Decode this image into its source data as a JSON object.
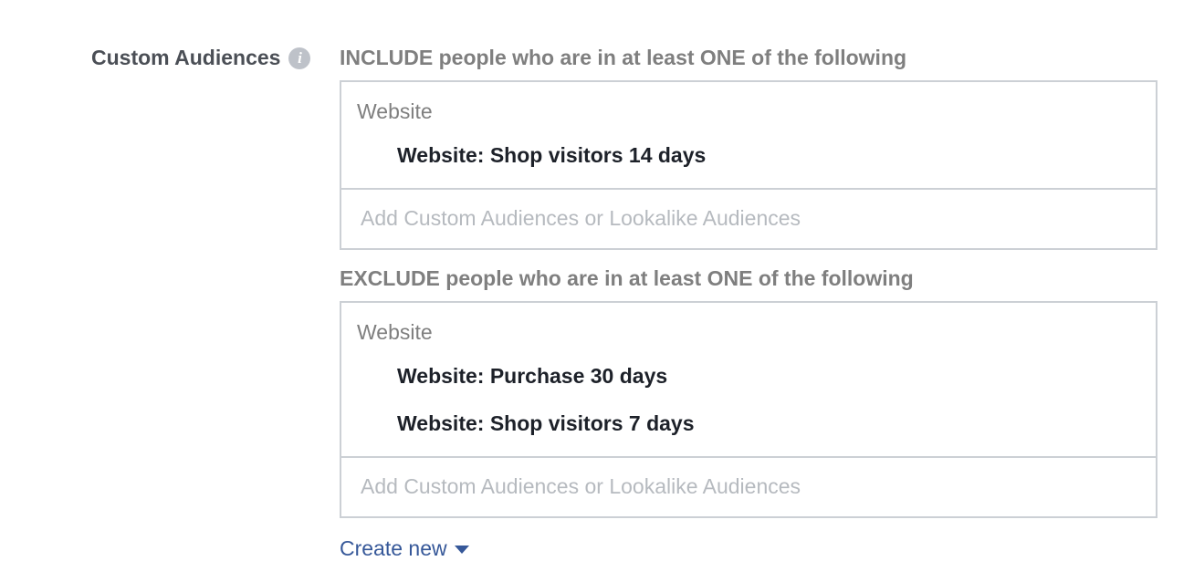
{
  "custom_audiences": {
    "label": "Custom Audiences",
    "info_icon": "i"
  },
  "include": {
    "heading": "INCLUDE people who are in at least ONE of the following",
    "group_label": "Website",
    "items": [
      "Website: Shop visitors 14 days"
    ],
    "placeholder": "Add Custom Audiences or Lookalike Audiences"
  },
  "exclude": {
    "heading": "EXCLUDE people who are in at least ONE of the following",
    "group_label": "Website",
    "items": [
      "Website: Purchase 30 days",
      "Website: Shop visitors 7 days"
    ],
    "placeholder": "Add Custom Audiences or Lookalike Audiences"
  },
  "create_new": {
    "label": "Create new",
    "icon": "caret-down-icon"
  },
  "colors": {
    "label_gray": "#4b4f56",
    "heading_gray": "#7f7f7f",
    "border": "#ccd0d5",
    "link_blue": "#365899",
    "placeholder": "#b6babf"
  }
}
